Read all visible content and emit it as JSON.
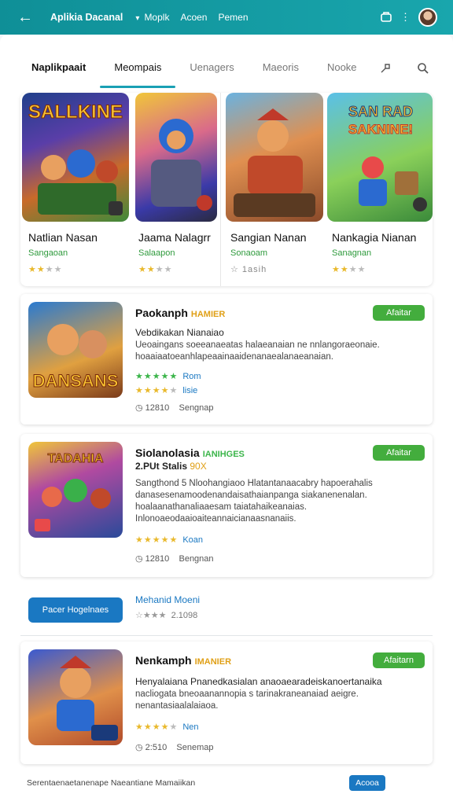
{
  "topbar": {
    "back_icon": "arrow-left-icon",
    "title": "Aplikia Dacanal",
    "nav": [
      "Moplk",
      "Acoen",
      "Pemen"
    ],
    "cart_icon": "bag-icon",
    "more": "⋮"
  },
  "tabs": {
    "items": [
      "Naplikpaait",
      "Meompais",
      "Uenagers",
      "Maeoris",
      "Nooke"
    ],
    "active_index": 1
  },
  "featured": [
    {
      "name": "Natlian Nasan",
      "sub": "Sangaoan",
      "rating": 2.5
    },
    {
      "name": "Jaama Nalagrr",
      "sub": "Salaapon",
      "rating": 2.5
    },
    {
      "name": "Sangian Nanan",
      "sub": "Sonaoam",
      "rating": 0,
      "meta": "☆ 1asih"
    },
    {
      "name": "Nankagia Nianan",
      "sub": "Sanagnan",
      "rating": 2.5
    }
  ],
  "cards": [
    {
      "title": "Paokanph",
      "tag": "HAMIER",
      "badge": "Afaitar",
      "subtitle": "Vebdikakan Nianaiao",
      "desc": "Ueoaingans soeeanaeatas halaeanaian ne nnlangoraeonaie. hoaaiaatoeanhlapeaainaaidenanaealanaeanaian.",
      "rating_text": "Rom",
      "rating_text2": "lisie",
      "meta_count": "12810",
      "meta_label": "Sengnap"
    },
    {
      "title": "Siolanolasia",
      "tag": "IANIHGES",
      "badge": "Afaitar",
      "subtitle": "2.PUt Stalis ",
      "subtitle_tag": "90X",
      "desc": "Sangthond 5 Nloohangiaoo Hlatantanaacabry hapoerahalis danasesenamoodenandaisathaianpanga siakanenenalan. hoalaanathanaliaaesam taiatahaikeanaias. Inlonoaeodaaioaiteannaicianaasnanaiis.",
      "rating_text": "Koan",
      "meta_count": "12810",
      "meta_label": "Bengnan"
    },
    {
      "title": "Nenkamph",
      "tag": "IMANIER",
      "badge": "Afaitarn",
      "subtitle": "Henyalaiana Pnanedkasialan anaoaearadeiskanoertanaika",
      "desc": "nacliogata bneoaanannopia s tarinakraneanaiad aeigre. nenantasiaalalaiaoa.",
      "rating_text": "Nen",
      "meta_count": "2:510",
      "meta_label": "Senemap"
    }
  ],
  "promo": {
    "button": "Pacer Hogelnaes",
    "title": "Mehanid Moeni",
    "rating_count": "2.1098"
  },
  "footer": {
    "text": "Serentaenaetanenape Naeantiane Mamaiikan",
    "button": "Acooa"
  },
  "colors": {
    "topbar": "#129aa2",
    "accent_tab": "#1aa0b4",
    "badge_green": "#43ad3d",
    "link_blue": "#1a78c2",
    "star_yellow": "#e9b92c"
  }
}
